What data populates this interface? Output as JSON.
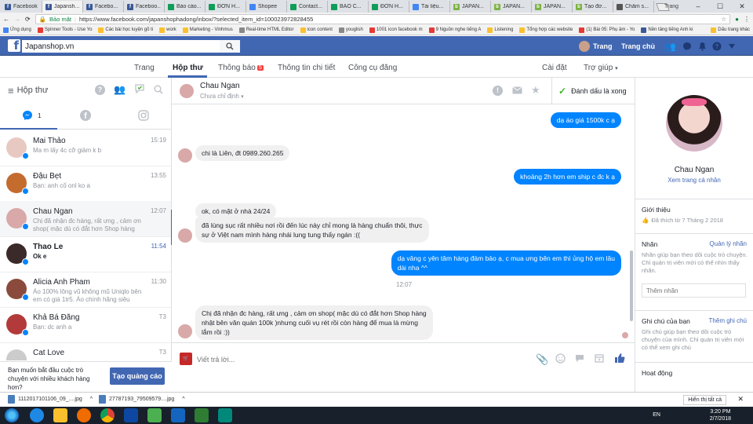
{
  "browser": {
    "tabs": [
      {
        "label": "Facebook",
        "color": "#3b5998",
        "glyph": "f",
        "active": false
      },
      {
        "label": "Japansh...",
        "color": "#3b5998",
        "glyph": "f",
        "active": true
      },
      {
        "label": "Facebo...",
        "color": "#3b5998",
        "glyph": "f",
        "active": false
      },
      {
        "label": "Faceboo...",
        "color": "#3b5998",
        "glyph": "f",
        "active": false
      },
      {
        "label": "Báo cáo...",
        "color": "#0f9d58",
        "glyph": "",
        "active": false
      },
      {
        "label": "ĐƠN H...",
        "color": "#0f9d58",
        "glyph": "",
        "active": false
      },
      {
        "label": "Shopee",
        "color": "#4285f4",
        "glyph": "",
        "active": false
      },
      {
        "label": "Contact...",
        "color": "#0f9d58",
        "glyph": "",
        "active": false
      },
      {
        "label": "BÁO C...",
        "color": "#0f9d58",
        "glyph": "",
        "active": false
      },
      {
        "label": "ĐƠN H...",
        "color": "#0f9d58",
        "glyph": "",
        "active": false
      },
      {
        "label": "Tài liệu...",
        "color": "#4285f4",
        "glyph": "",
        "active": false
      },
      {
        "label": "JAPAN...",
        "color": "#7cb342",
        "glyph": "b",
        "active": false
      },
      {
        "label": "JAPAN...",
        "color": "#7cb342",
        "glyph": "b",
        "active": false
      },
      {
        "label": "JAPAN...",
        "color": "#7cb342",
        "glyph": "b",
        "active": false
      },
      {
        "label": "Tạo đơ...",
        "color": "#7cb342",
        "glyph": "b",
        "active": false
      },
      {
        "label": "Chăm s...",
        "color": "#555",
        "glyph": "",
        "active": false
      }
    ],
    "profile_label": "Trang",
    "secure_label": "Bảo mật",
    "url": "https://www.facebook.com/japanshophadong/inbox/?selected_item_id=100023972828455",
    "bookmarks": [
      {
        "label": "Ứng dụng",
        "color": "#4285f4"
      },
      {
        "label": "Spinner Tools - Use Yo",
        "color": "#e53935"
      },
      {
        "label": "Các bài học luyện gõ ti",
        "color": "#fbc02d"
      },
      {
        "label": "work",
        "color": "#fbc02d"
      },
      {
        "label": "Marketing - Vinhmus",
        "color": "#fbc02d"
      },
      {
        "label": "Real-time HTML Editor",
        "color": "#888"
      },
      {
        "label": "icon content",
        "color": "#fbc02d"
      },
      {
        "label": "youglish",
        "color": "#888"
      },
      {
        "label": "1001 icon facebook m",
        "color": "#e53935"
      },
      {
        "label": "9 Nguồn nghe tiếng A",
        "color": "#e53935"
      },
      {
        "label": "Listening",
        "color": "#fbc02d"
      },
      {
        "label": "Tổng hợp các website",
        "color": "#fbc02d"
      },
      {
        "label": "(1) Bài 05: Phụ âm - Yo",
        "color": "#e53935"
      },
      {
        "label": "Nền tảng tiếng Anh ki",
        "color": "#3b5998"
      },
      {
        "label": "Dấu trang khác",
        "color": "#fbc02d"
      }
    ]
  },
  "fb": {
    "search_value": "Japanshop.vn",
    "user_name": "Trang",
    "home_label": "Trang chủ"
  },
  "page_nav": {
    "items": [
      "Trang",
      "Hộp thư",
      "Thông báo",
      "Thông tin chi tiết",
      "Công cụ đăng"
    ],
    "notif_count": "5",
    "settings": "Cài đặt",
    "help": "Trợ giúp"
  },
  "inbox": {
    "title": "Hộp thư",
    "messenger_count": "1",
    "conversations": [
      {
        "name": "Mai Thảo",
        "time": "15:19",
        "preview": "Ma m lấy 4c cỡ giảm k b",
        "bold": false,
        "avatar": "#e8c9c2"
      },
      {
        "name": "Đậu Bẹt",
        "time": "13:55",
        "preview": "Bạn: anh cố onl ko a",
        "bold": false,
        "avatar": "#c46b2e"
      },
      {
        "name": "Chau Ngan",
        "time": "12:07",
        "preview": "Chị đã nhận đc hàng, rất ưng , cảm ơn shop( mặc dù có đắt hơn Shop hàng nh...",
        "bold": false,
        "avatar": "#d9a8a8"
      },
      {
        "name": "Thao Le",
        "time": "11:54",
        "preview": "Ok e",
        "bold": true,
        "avatar": "#3a2a2a"
      },
      {
        "name": "Alicia Anh Pham",
        "time": "11:30",
        "preview": "Ảo 100% lông vũ không mũ Uniqlo bên em có giá 1tr5. Áo chính hãng siêu nhẹ,...",
        "bold": false,
        "avatar": "#8a4b3c"
      },
      {
        "name": "Khả Bá Đăng",
        "time": "T3",
        "preview": "Bạn: dc anh a",
        "bold": false,
        "avatar": "#b33a3a"
      },
      {
        "name": "Cat Love",
        "time": "T3",
        "preview": "",
        "bold": false,
        "avatar": "#ccc"
      }
    ],
    "ad_text": "Bạn muốn bắt đầu cuộc trò chuyện với nhiều khách hàng hơn?",
    "ad_button": "Tạo quảng cáo"
  },
  "chat": {
    "name": "Chau Ngan",
    "assign": "Chưa chỉ định",
    "done_label": "Đánh dấu là xong",
    "messages": [
      {
        "dir": "out",
        "text": "dạ áo giá 1500k c ạ"
      },
      {
        "dir": "in",
        "text": "chi là Liên, đt 0989.260.265"
      },
      {
        "dir": "out",
        "text": "khoảng 2h hơn em ship c đc k ạ"
      },
      {
        "dir": "in",
        "text": "ok, có mặt ở nhà 24/24"
      },
      {
        "dir": "in",
        "text": "đã lùng sục rất nhiều nơi rồi đến lúc này chỉ mong là hàng chuẩn thôi, thực\nsự ở Việt nam mình hàng nhái lung tung thấy ngán :(("
      },
      {
        "dir": "out",
        "text": "dạ vâng c yên tâm hàng đảm bảo ạ, c mua ưng bên em thì ủng hộ em lâu\ndài nha ^^"
      },
      {
        "dir": "in",
        "text": "Chị đã nhận đc hàng, rất ưng , cảm ơn shop( mặc dù có đắt hơn Shop hàng\nnhật bên văn quán 100k )nhưng cuối vụ rét rồi còn hàng để mua là mừng\nlắm rồi :))"
      }
    ],
    "timestamp": "12:07",
    "placeholder": "Viết trả lời..."
  },
  "profile": {
    "name": "Chau Ngan",
    "view_profile": "Xem trang cá nhân",
    "intro_title": "Giới thiệu",
    "intro_text": "Đã thích từ 7 Tháng 2 2018",
    "labels_title": "Nhãn",
    "labels_link": "Quản lý nhãn",
    "labels_text": "Nhãn giúp bạn theo dõi cuộc trò chuyện. Chỉ quản trị viên mới có thể nhìn thấy nhãn.",
    "add_label_placeholder": "Thêm nhãn",
    "notes_title": "Ghi chú của bạn",
    "notes_link": "Thêm ghi chú",
    "notes_text": "Ghi chú giúp bạn theo dõi cuộc trò chuyện của mình. Chỉ quản trị viên mới có thể xem ghi chú",
    "activity_title": "Hoạt động"
  },
  "downloads": {
    "files": [
      "1112017101106_09_....jpg",
      "27787193_79509579....jpg"
    ],
    "show_all": "Hiển thị tất cả"
  },
  "taskbar": {
    "lang": "EN",
    "time": "3:20 PM",
    "date": "2/7/2018"
  }
}
